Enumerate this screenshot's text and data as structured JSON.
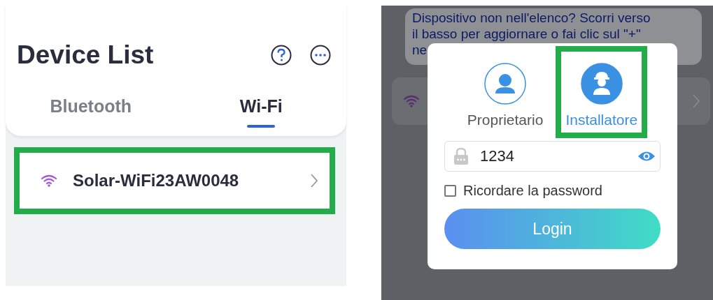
{
  "device_list": {
    "title": "Device List",
    "tabs": [
      {
        "label": "Bluetooth",
        "selected": false
      },
      {
        "label": "Wi-Fi",
        "selected": true
      }
    ],
    "devices": [
      {
        "name": "Solar-WiFi23AW0048",
        "highlighted": true
      }
    ]
  },
  "login_screen": {
    "hint_lines": [
      "Dispositivo non nell'elenco? Scorri verso",
      "il basso per aggiornare o fai clic sul \"+\"",
      "ne"
    ],
    "roles": [
      {
        "label": "Proprietario",
        "kind": "owner",
        "selected": false,
        "highlighted": false
      },
      {
        "label": "Installatore",
        "kind": "installer",
        "selected": true,
        "highlighted": true
      }
    ],
    "password": {
      "value": "1234"
    },
    "remember_password": {
      "label": "Ricordare la password",
      "checked": false
    },
    "login_button": "Login"
  }
}
